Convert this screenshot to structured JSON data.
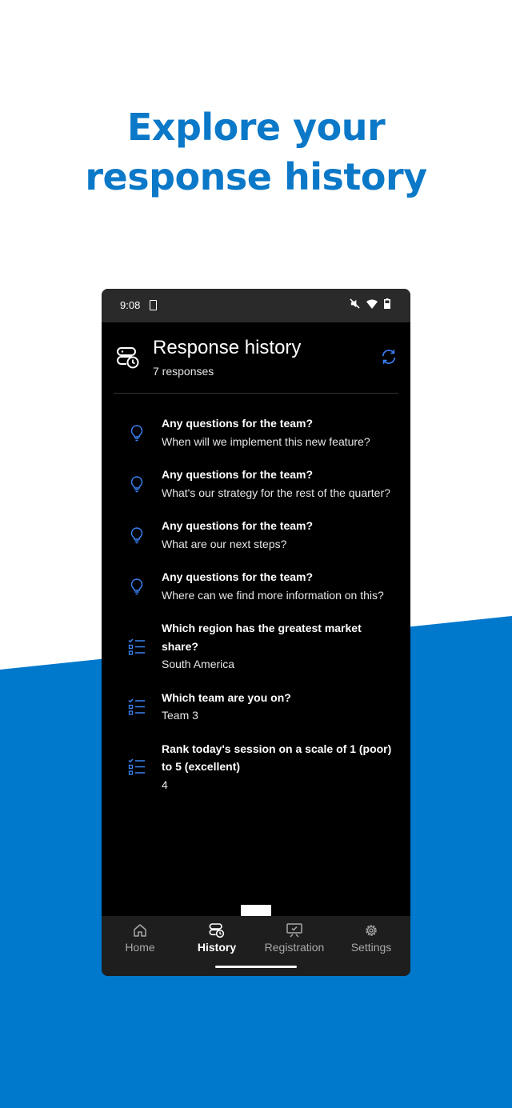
{
  "headline": {
    "line1": "Explore your",
    "line2": "response history"
  },
  "status_bar": {
    "time": "9:08",
    "icons": [
      "sim-icon",
      "mute-icon",
      "wifi-icon",
      "battery-icon"
    ]
  },
  "header": {
    "icon": "history-icon",
    "title": "Response history",
    "subtitle": "7 responses",
    "refresh_icon": "refresh-icon"
  },
  "responses": [
    {
      "icon": "lightbulb-icon",
      "question": "Any questions for the team?",
      "answer": "When will we implement this new feature?"
    },
    {
      "icon": "lightbulb-icon",
      "question": "Any questions for the team?",
      "answer": "What's our strategy for the rest of the quarter?"
    },
    {
      "icon": "lightbulb-icon",
      "question": "Any questions for the team?",
      "answer": "What are our next steps?"
    },
    {
      "icon": "lightbulb-icon",
      "question": "Any questions for the team?",
      "answer": "Where can we find more information on this?"
    },
    {
      "icon": "checklist-icon",
      "question": "Which region has the greatest market share?",
      "answer": "South America"
    },
    {
      "icon": "checklist-icon",
      "question": "Which team are you on?",
      "answer": "Team 3"
    },
    {
      "icon": "checklist-icon",
      "question": "Rank today's session on a scale of 1 (poor) to 5 (excellent)",
      "answer": "4"
    }
  ],
  "bottom_nav": {
    "items": [
      {
        "label": "Home",
        "icon": "home-icon",
        "active": false
      },
      {
        "label": "History",
        "icon": "history-icon",
        "active": true
      },
      {
        "label": "Registration",
        "icon": "registration-icon",
        "active": false
      },
      {
        "label": "Settings",
        "icon": "gear-icon",
        "active": false
      }
    ]
  },
  "colors": {
    "brand_blue": "#0078cc",
    "icon_blue": "#3b82f6",
    "headline_blue": "#0b78c8"
  }
}
